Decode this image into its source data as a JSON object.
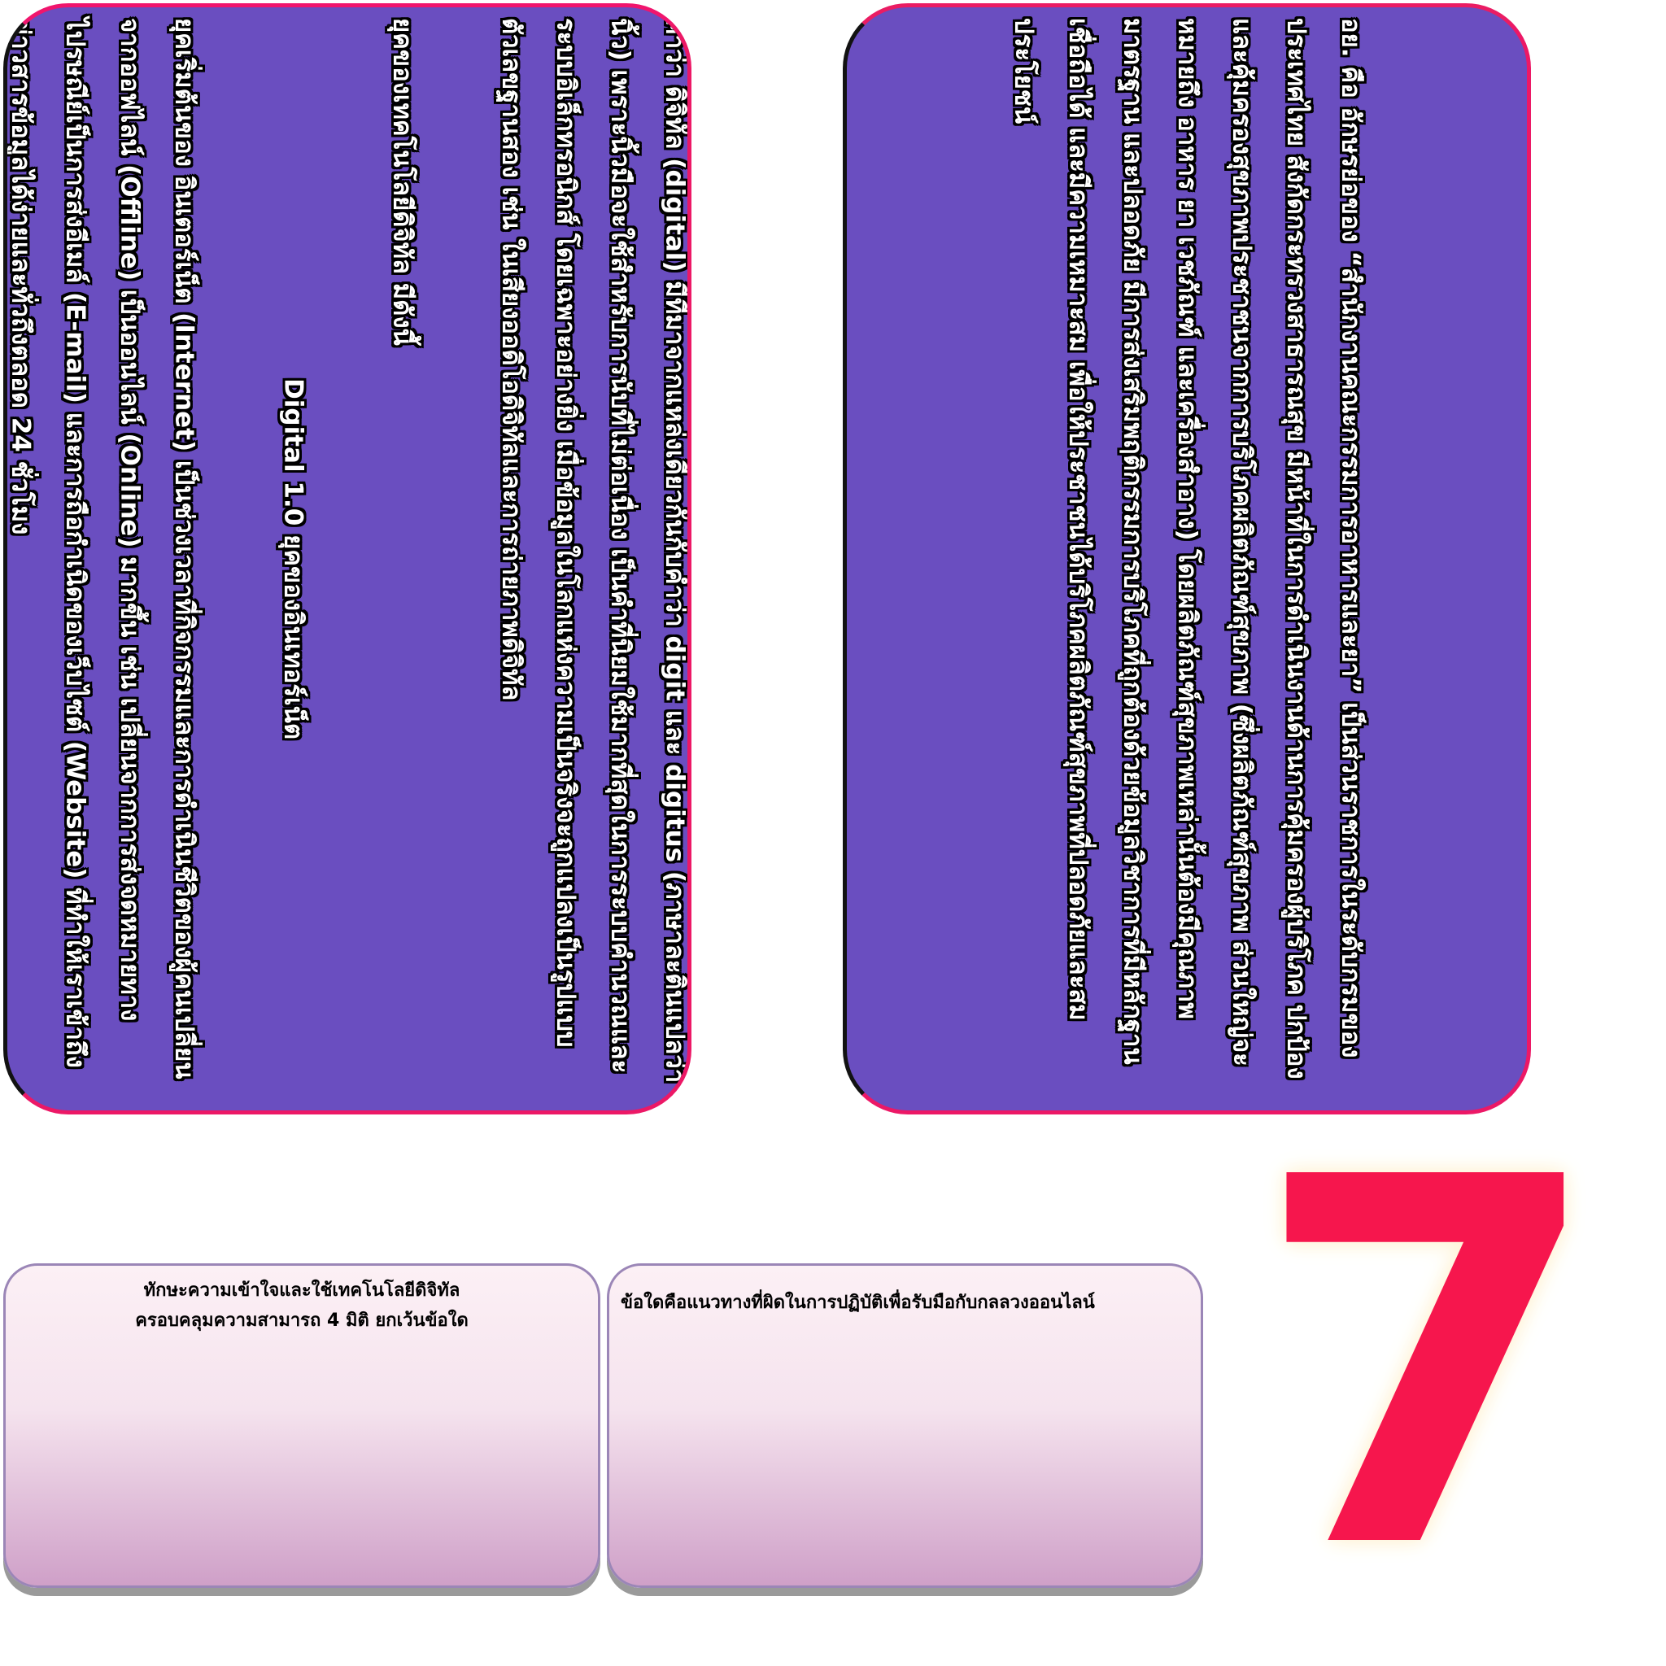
{
  "left_card": {
    "paragraph1": "คำว่า ดิจิทัล (digital) มีที่มาจากแหล่งเดียวกันกับคำว่า digit และ digitus (ภาษาละตินแปลว่านิ้ว) เพราะนิ้วมือจะใช้สำหรับการนับที่ไม่ต่อเนื่อง เป็นคำที่นิยมใช้มากที่สุดในการระบบคำนวณและระบบอิเล็กทรอนิกส์ โดยเฉพาะอย่างยิ่ง เมื่อข้อมูลในโลกแห่งความเป็นจริงจะถูกแปลงเป็นรูปแบบตัวเลขฐานสอง เช่น ในเสียงออดิโอดิจิทัลและการถ่ายภาพดิจิทัล",
    "heading": "ยุคของเทคโนโลยีดิจิทัล มีดังนี้",
    "subheading": "Digital 1.0 ยุคของอินเทอร์เน็ต",
    "paragraph2": "ยุคเริ่มต้นของ อินเตอร์เน็ต (Internet) เป็นช่วงเวลาที่กิจกรรมและการดำเนินชีวิตของผู้คนเปลี่ยนจากออฟไลน์ (Offline) เป็นออนไลน์ (Online) มากขึ้น เช่น เปลี่ยนจากการส่งจดหมายทางไปรษณีย์เป็นการส่งอีเมล์ (E-mail) และการถือกำเนิดของเว็บไซต์ (Website) ที่ทำให้เราเข้าถึงข่าวสารข้อมูลได้ง่ายและทั่วถึงตลอด 24 ชั่วโมง"
  },
  "right_card": {
    "paragraph": "อย. คือ อักษรย่อของ “สำนักงานคณะกรรมการอาหารและยา” เป็นส่วนราชการในระดับกรมของประเทศไทย สังกัดกระทรวงสาธารณสุข มีหน้าที่ในการดำเนินงานด้านการคุ้มครองผู้บริโภค ปกป้อง และคุ้มครองสุขภาพประชาชนจากการบริโภคผลิตภัณฑ์สุขภาพ (ซึ่งผลิตภัณฑ์สุขภาพ ส่วนใหญ่จะหมายถึง อาหาร ยา เวชภัณฑ์ และเครื่องสำอาง) โดยผลิตภัณฑ์สุขภาพเหล่านั้นต้องมีคุณภาพมาตรฐาน และปลอดภัย มีการส่งเสริมพฤติกรรมการบริโภคที่ถูกต้องด้วยข้อมูลวิชาการที่มีหลักฐาน เชื่อถือได้ และมีความเหมาะสม เพื่อให้ประชาชนได้บริโภคผลิตภัณฑ์สุขภาพที่ปลอดภัยและสมประโยชน์"
  },
  "question_left": {
    "line1": "ทักษะความเข้าใจและใช้เทคโนโลยีดิจิทัล",
    "line2": "ครอบคลุมความสามารถ 4 มิติ ยกเว้นข้อใด"
  },
  "question_right": {
    "line1": "ข้อใดคือแนวทางที่ผิดในการปฏิบัติเพื่อรับมือกับกลลวงออนไลน์"
  },
  "question_number": "7",
  "colors": {
    "card_fill": "#6a4ec0",
    "card_border": "#ec1866",
    "number_color": "#f6164d"
  }
}
